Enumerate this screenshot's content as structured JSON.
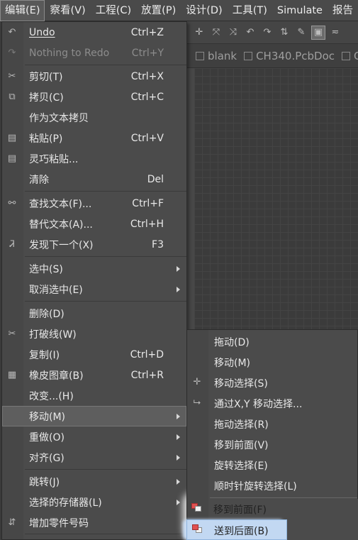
{
  "menubar": [
    "编辑(E)",
    "察看(V)",
    "工程(C)",
    "放置(P)",
    "设计(D)",
    "工具(T)",
    "Simulate",
    "报告"
  ],
  "tabs": [
    "blank",
    "CH340.PcbDoc",
    "G"
  ],
  "menu": {
    "items": [
      {
        "label": "Undo",
        "shortcut": "Ctrl+Z",
        "icon": "undo-icon"
      },
      {
        "label": "Nothing to Redo",
        "shortcut": "Ctrl+Y",
        "icon": "redo-icon",
        "disabled": true
      },
      {
        "label": "剪切(T)",
        "shortcut": "Ctrl+X",
        "icon": "scissors-icon"
      },
      {
        "label": "拷贝(C)",
        "shortcut": "Ctrl+C",
        "icon": "copy-icon"
      },
      {
        "label": "作为文本拷贝",
        "shortcut": "",
        "icon": ""
      },
      {
        "label": "粘贴(P)",
        "shortcut": "Ctrl+V",
        "icon": "paste-icon"
      },
      {
        "label": "灵巧粘贴...",
        "shortcut": "",
        "icon": "smart-paste-icon"
      },
      {
        "label": "清除",
        "shortcut": "Del",
        "icon": ""
      },
      {
        "label": "查找文本(F)...",
        "shortcut": "Ctrl+F",
        "icon": "binoculars-icon"
      },
      {
        "label": "替代文本(A)...",
        "shortcut": "Ctrl+H",
        "icon": ""
      },
      {
        "label": "发现下一个(X)",
        "shortcut": "F3",
        "icon": "find-next-icon"
      },
      {
        "label": "选中(S)",
        "shortcut": "",
        "icon": "",
        "submenu": true
      },
      {
        "label": "取消选中(E)",
        "shortcut": "",
        "icon": "",
        "submenu": true
      },
      {
        "label": "删除(D)",
        "shortcut": "",
        "icon": ""
      },
      {
        "label": "打破线(W)",
        "shortcut": "",
        "icon": "break-wire-icon"
      },
      {
        "label": "复制(I)",
        "shortcut": "Ctrl+D",
        "icon": ""
      },
      {
        "label": "橡皮图章(B)",
        "shortcut": "Ctrl+R",
        "icon": "rubber-stamp-icon"
      },
      {
        "label": "改变...(H)",
        "shortcut": "",
        "icon": ""
      },
      {
        "label": "移动(M)",
        "shortcut": "",
        "icon": "",
        "submenu": true,
        "highlight": true
      },
      {
        "label": "重做(O)",
        "shortcut": "",
        "icon": "",
        "submenu": true
      },
      {
        "label": "对齐(G)",
        "shortcut": "",
        "icon": "",
        "submenu": true
      },
      {
        "label": "跳转(J)",
        "shortcut": "",
        "icon": "",
        "submenu": true
      },
      {
        "label": "选择的存储器(L)",
        "shortcut": "",
        "icon": "",
        "submenu": true
      },
      {
        "label": "增加零件号码",
        "shortcut": "",
        "icon": "increment-icon"
      }
    ]
  },
  "submenu": {
    "items": [
      {
        "label": "拖动(D)",
        "icon": ""
      },
      {
        "label": "移动(M)",
        "icon": ""
      },
      {
        "label": "移动选择(S)",
        "icon": "move-cross-icon"
      },
      {
        "label": "通过X,Y 移动选择...",
        "icon": "move-xy-icon"
      },
      {
        "label": "拖动选择(R)",
        "icon": ""
      },
      {
        "label": "移到前面(V)",
        "icon": ""
      },
      {
        "label": "旋转选择(E)",
        "icon": ""
      },
      {
        "label": "顺时针旋转选择(L)",
        "icon": ""
      },
      {
        "label": "移到前面(F)",
        "icon": "bring-front-icon"
      },
      {
        "label": "送到后面(B)",
        "icon": "send-back-icon",
        "highlight": true
      }
    ]
  },
  "colors": {
    "highlight": "#4f6f96",
    "menu_bg": "#4b4b4b"
  }
}
